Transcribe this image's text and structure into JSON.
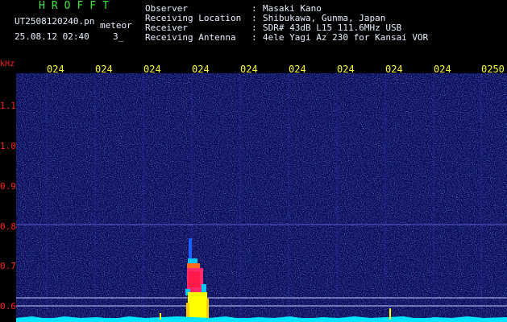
{
  "header": {
    "app_title": "HROFFT",
    "filename": "UT2508120240.pn",
    "mode": "meteor",
    "datetime": "25.08.12 02:40",
    "count": "3_",
    "info": [
      {
        "key": "Observer",
        "value": "Masaki Kano"
      },
      {
        "key": "Receiving Location",
        "value": "Shibukawa, Gunma, Japan"
      },
      {
        "key": "Receiver",
        "value": "SDR# 43dB L15 111.6MHz USB"
      },
      {
        "key": "Receiving Antenna",
        "value": "4ele Yagi Az 230 for Kansai VOR"
      }
    ]
  },
  "spectrogram": {
    "unit_label": "kHz",
    "time_ticks": [
      "024",
      "024",
      "024",
      "024",
      "024",
      "024",
      "024",
      "024",
      "024",
      "0250"
    ],
    "freq_ticks": [
      "1.1",
      "1.0",
      "0.9",
      "0.8",
      "0.7",
      "0.6"
    ],
    "colors": {
      "background": "#0a0a55",
      "noise": "#1e3cc8",
      "tick_time": "#ffff33",
      "tick_freq": "#ff2020",
      "baseline": "#00e5ff",
      "meteor_core": "#ffff00",
      "meteor_mid": "#ff2a6a",
      "meteor_edge": "#00c8ff"
    }
  }
}
